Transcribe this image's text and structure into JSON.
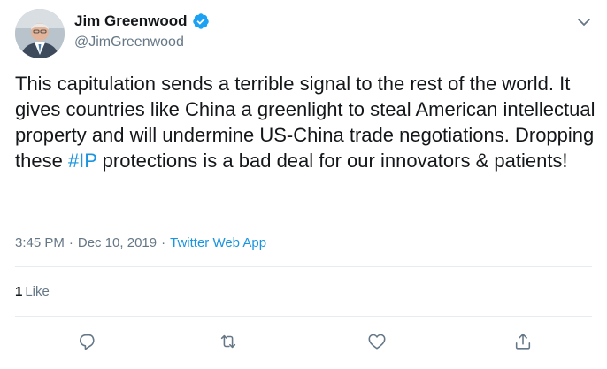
{
  "author": {
    "display_name": "Jim Greenwood",
    "handle": "@JimGreenwood",
    "verified": true
  },
  "tweet": {
    "text_before": "This capitulation sends a terrible signal to the rest of the world. It gives countries like China a greenlight to steal American intellectual property and will undermine US-China trade negotiations. Dropping these ",
    "hashtag": "#IP",
    "text_after": " protections is a bad deal for our innovators & patients!"
  },
  "meta": {
    "time": "3:45 PM",
    "separator": "·",
    "date": "Dec 10, 2019",
    "source": "Twitter Web App"
  },
  "stats": {
    "likes_count": "1",
    "likes_label": "Like"
  },
  "actions": {
    "reply_icon": "reply-icon",
    "retweet_icon": "retweet-icon",
    "like_icon": "heart-icon",
    "share_icon": "share-icon"
  },
  "colors": {
    "link": "#1b95e0",
    "secondary_text": "#657786",
    "primary_text": "#14171a",
    "divider": "#e6ecf0"
  }
}
